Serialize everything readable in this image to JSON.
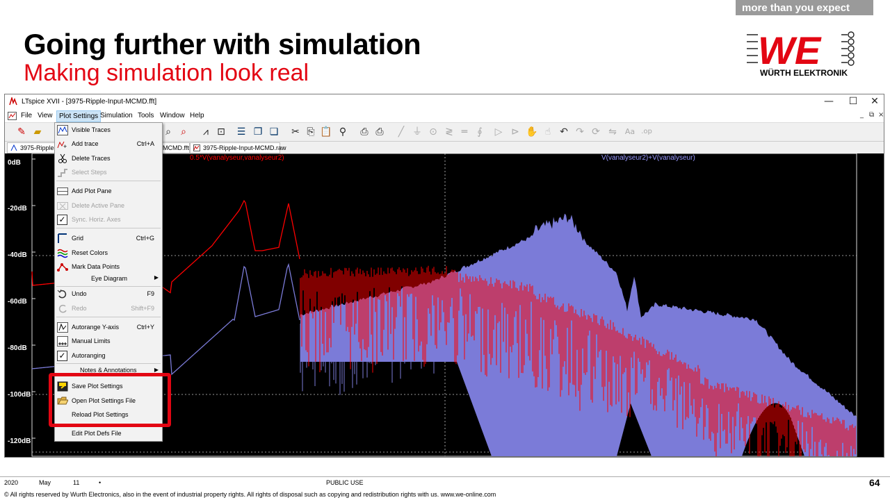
{
  "header": {
    "tagline": "more than you expect",
    "title": "Going further with simulation",
    "subtitle": "Making simulation look real",
    "logo_text": "WÜRTH ELEKTRONIK",
    "logo_letters": "WE",
    "brand_color": "#e30613"
  },
  "window": {
    "title": "LTspice XVII - [3975-Ripple-Input-MCMD.fft]",
    "controls": [
      "—",
      "☐",
      "✕"
    ],
    "mdi_controls": [
      "_",
      "⧉",
      "×"
    ]
  },
  "menubar": [
    {
      "label": "File"
    },
    {
      "label": "View"
    },
    {
      "label": "Plot Settings",
      "active": true
    },
    {
      "label": "Simulation"
    },
    {
      "label": "Tools"
    },
    {
      "label": "Window"
    },
    {
      "label": "Help"
    }
  ],
  "toolbar_icons": [
    "new-schematic-icon",
    "open-icon",
    "zoom-in-icon",
    "zoom-cancel-icon",
    "autorange-icon",
    "fit-icon",
    "tile-icon",
    "cascade-icon",
    "arrange-icon",
    "cut-icon",
    "copy-icon",
    "paste-icon",
    "find-icon",
    "print-icon",
    "print-setup-icon",
    "wire-icon",
    "ground-icon",
    "label-icon",
    "resistor-icon",
    "capacitor-icon",
    "inductor-icon",
    "diode-icon",
    "component-icon",
    "move-icon",
    "drag-icon",
    "undo-icon",
    "redo-icon",
    "rotate-icon",
    "mirror-icon",
    "text-icon",
    "spice-directive-icon"
  ],
  "tabs": [
    {
      "label": "3975-Ripple-"
    },
    {
      "label": "MCMD.fft"
    },
    {
      "label": "3975-Ripple-Input-MCMD.raw"
    }
  ],
  "plot": {
    "y_ticks": [
      "0dB",
      "-20dB",
      "-40dB",
      "-60dB",
      "-80dB",
      "-100dB",
      "-120dB"
    ],
    "trace1_label": "0.5*V(vanalyseur,vanalyseur2)",
    "trace2_label": "V(vanalyseur2)+V(vanalyseur)",
    "trace1_color": "#ff0000",
    "trace2_color": "#7b7bd8"
  },
  "menu": {
    "items": [
      {
        "label": "Visible Traces",
        "shortcut": "",
        "disabled": false
      },
      {
        "label": "Add trace",
        "shortcut": "Ctrl+A",
        "disabled": false
      },
      {
        "label": "Delete Traces",
        "shortcut": "",
        "disabled": false
      },
      {
        "label": "Select Steps",
        "shortcut": "",
        "disabled": true
      },
      {
        "label": "Add Plot Pane",
        "shortcut": "",
        "disabled": false
      },
      {
        "label": "Delete Active Pane",
        "shortcut": "",
        "disabled": true
      },
      {
        "label": "Sync. Horiz. Axes",
        "shortcut": "",
        "disabled": true
      },
      {
        "label": "Grid",
        "shortcut": "Ctrl+G",
        "disabled": false
      },
      {
        "label": "Reset Colors",
        "shortcut": "",
        "disabled": false
      },
      {
        "label": "Mark Data Points",
        "shortcut": "",
        "disabled": false
      },
      {
        "label": "Eye Diagram",
        "shortcut": "",
        "disabled": false
      },
      {
        "label": "Undo",
        "shortcut": "F9",
        "disabled": false
      },
      {
        "label": "Redo",
        "shortcut": "Shift+F9",
        "disabled": true
      },
      {
        "label": "Autorange Y-axis",
        "shortcut": "Ctrl+Y",
        "disabled": false
      },
      {
        "label": "Manual Limits",
        "shortcut": "",
        "disabled": false
      },
      {
        "label": "Autoranging",
        "shortcut": "",
        "disabled": false
      },
      {
        "label": "Notes & Annotations",
        "shortcut": "",
        "disabled": false
      },
      {
        "label": "Save Plot Settings",
        "shortcut": "",
        "disabled": false
      },
      {
        "label": "Open Plot Settings File",
        "shortcut": "",
        "disabled": false
      },
      {
        "label": "Reload Plot Settings",
        "shortcut": "",
        "disabled": false
      },
      {
        "label": "Edit Plot Defs File",
        "shortcut": "",
        "disabled": false
      }
    ],
    "checked": [
      "Sync. Horiz. Axes",
      "Autoranging"
    ]
  },
  "footer": {
    "year": "2020",
    "month": "May",
    "day": "11",
    "bullet": "•",
    "classification": "PUBLIC USE",
    "page": "64",
    "copyright": "© All rights reserved by Wurth Electronics, also in the event of industrial property rights. All rights of disposal such as copying and redistribution rights with us. www.we-online.com"
  }
}
